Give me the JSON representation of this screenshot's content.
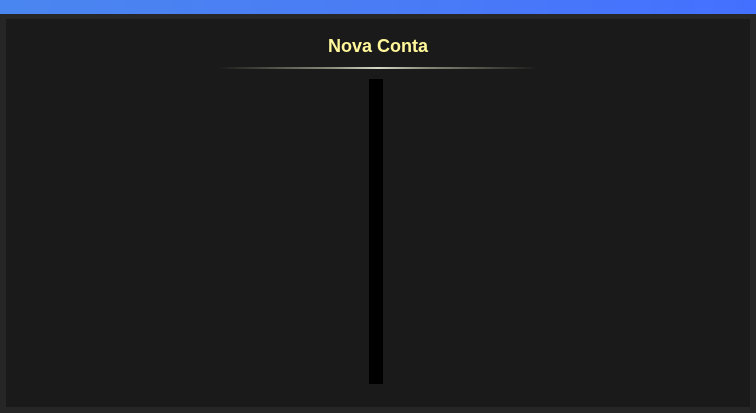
{
  "window": {
    "accent_color": "#4a7cf5"
  },
  "dialog": {
    "title": "Nova Conta",
    "title_color": "#fff79a",
    "background_color": "#1a1a1a"
  }
}
